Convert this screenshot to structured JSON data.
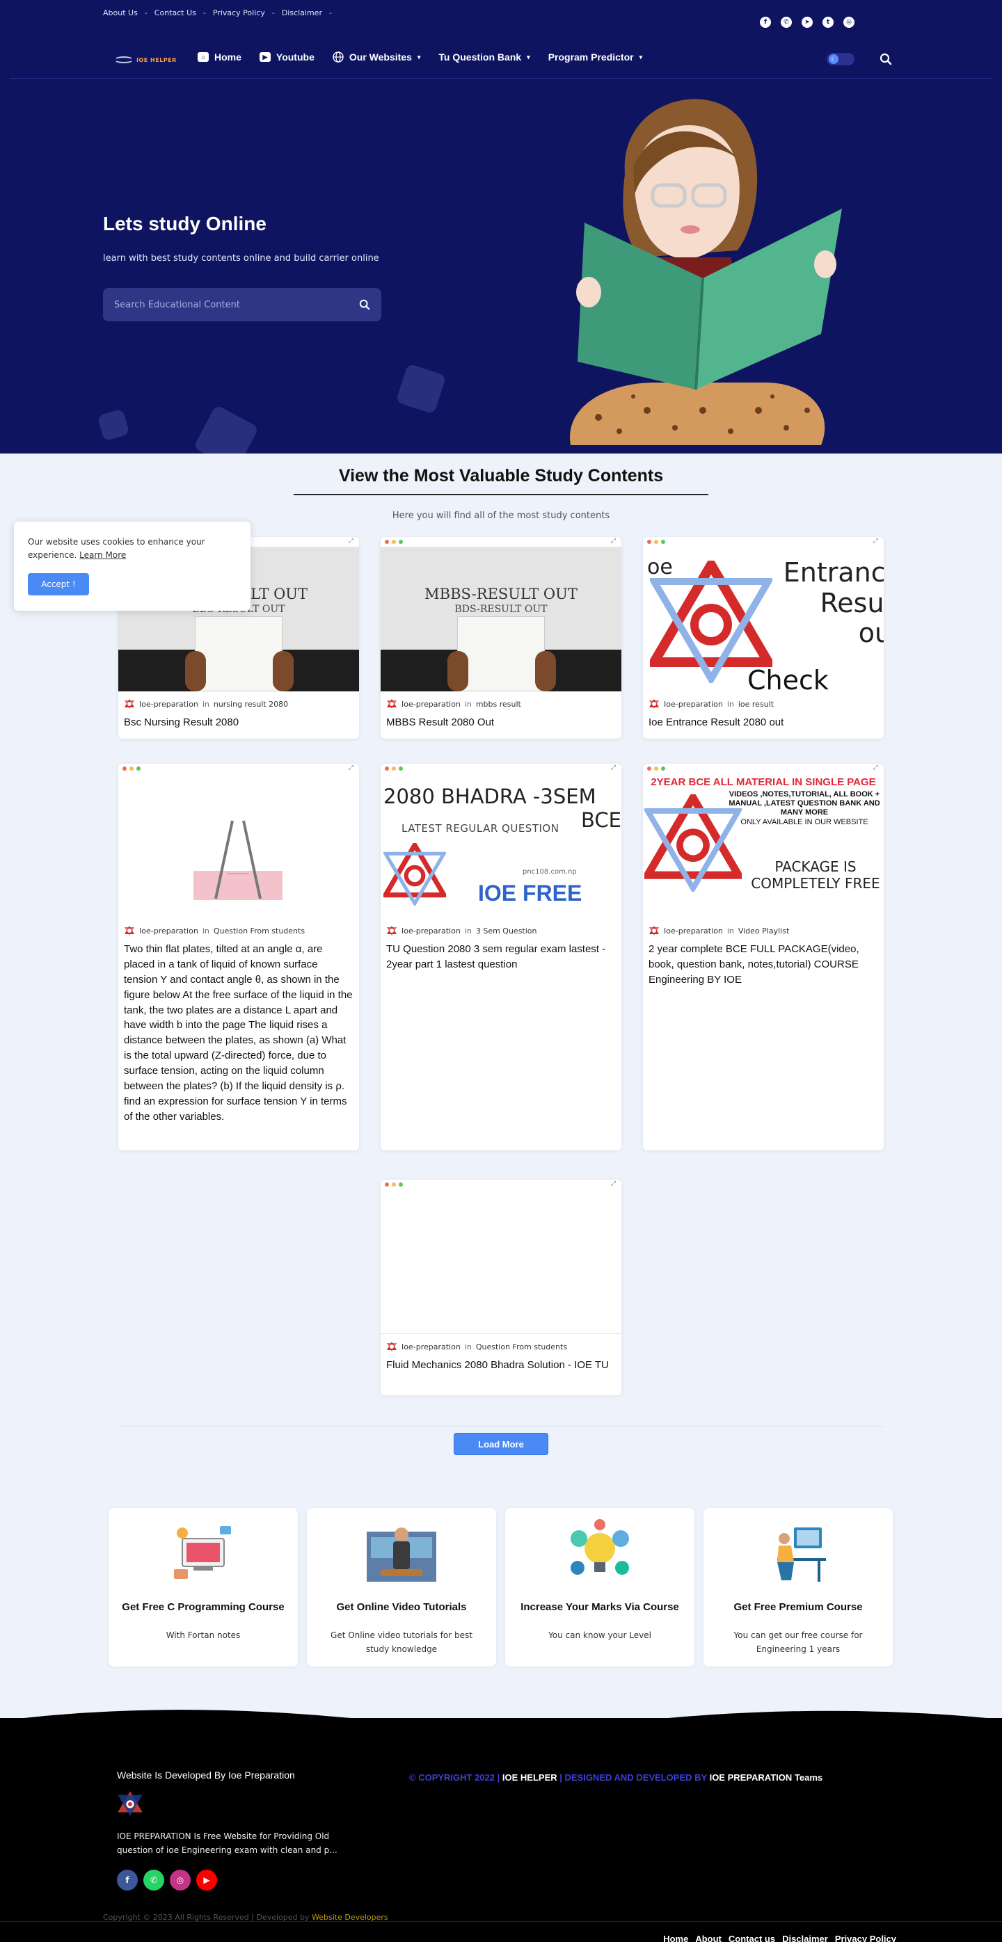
{
  "topbar": {
    "links": [
      "About Us",
      "Contact Us",
      "Privacy Policy",
      "Disclaimer"
    ],
    "separator": "-",
    "social_icons": [
      "facebook-icon",
      "whatsapp-icon",
      "telegram-icon",
      "twitter-icon",
      "instagram-icon"
    ]
  },
  "nav": {
    "logo_text": "IOE HELPER",
    "items": [
      {
        "label": "Home",
        "icon": "home-icon"
      },
      {
        "label": "Youtube",
        "icon": "youtube-icon"
      },
      {
        "label": "Our Websites",
        "icon": "globe-icon",
        "dropdown": true
      },
      {
        "label": "Tu Question Bank",
        "dropdown": true
      },
      {
        "label": "Program Predictor",
        "dropdown": true
      }
    ]
  },
  "hero": {
    "title": "Lets study Online",
    "subtitle": "learn with best study contents online and build carrier online",
    "search_placeholder": "Search Educational Content"
  },
  "section": {
    "title": "View the Most Valuable Study Contents",
    "subtitle": "Here you will find all of the most study contents"
  },
  "cookie": {
    "message": "Our website uses cookies to enhance your experience.",
    "learn_more": "Learn More",
    "accept": "Accept !"
  },
  "posts": [
    {
      "author": "Ioe-preparation",
      "in": "in",
      "category": "nursing result 2080",
      "title": "Bsc Nursing Result 2080",
      "thumb": {
        "line1": "BSC-RESULT OUT",
        "line2": "BDS-RESULT OUT"
      }
    },
    {
      "author": "Ioe-preparation",
      "in": "in",
      "category": "mbbs result",
      "title": "MBBS Result 2080 Out",
      "thumb": {
        "line1": "MBBS-RESULT OUT",
        "line2": "BDS-RESULT OUT"
      }
    },
    {
      "author": "Ioe-preparation",
      "in": "in",
      "category": "ioe result",
      "title": "Ioe Entrance Result 2080 out",
      "thumb": {
        "prefix": "oe",
        "line1": "Entrance",
        "line2": "Result",
        "line3": "out",
        "line4": "Check now"
      }
    },
    {
      "author": "Ioe-preparation",
      "in": "in",
      "category": "Question From students",
      "title": "Two thin flat plates, tilted at an angle α, are placed in a tank of liquid of known surface tension Y and contact angle θ, as shown in the figure below At the free surface of the liquid in the tank, the two plates are a distance L apart and have width b into the page The liquid rises a distance between the plates, as shown (a) What is the total upward (Z-directed) force, due to surface tension, acting on the liquid column between the plates? (b) If the liquid density is ρ. find an expression for surface tension Y in terms of the other variables."
    },
    {
      "author": "Ioe-preparation",
      "in": "in",
      "category": "3 Sem Question",
      "title": "TU Question 2080 3 sem regular exam lastest - 2year part 1 lastest question",
      "thumb": {
        "line1": "2080 BHADRA -3SEM",
        "line2": "BCE",
        "line3": "LATEST REGULAR QUESTION",
        "site": "pnc108.com.np",
        "brand": "IOE FREE"
      }
    },
    {
      "author": "Ioe-preparation",
      "in": "in",
      "category": "Video Playlist",
      "title": "2 year complete BCE FULL PACKAGE(video, book, question bank, notes,tutorial) COURSE Engineering BY IOE",
      "thumb": {
        "band": "2YEAR BCE ALL MATERIAL IN SINGLE PAGE",
        "list": "VIDEOS ,NOTES,TUTORIAL, ALL BOOK + MANUAL ,LATEST QUESTION BANK AND MANY MORE",
        "only": "ONLY AVAILABLE IN OUR WEBSITE",
        "package": "PACKAGE IS COMPLETELY FREE"
      }
    },
    {
      "author": "Ioe-preparation",
      "in": "in",
      "category": "Question From students",
      "title": "Fluid Mechanics 2080 Bhadra Solution - IOE TU"
    }
  ],
  "load_more": "Load More",
  "features": [
    {
      "title": "Get Free C Programming Course",
      "desc": "With Fortan notes"
    },
    {
      "title": "Get Online Video Tutorials",
      "desc": "Get Online video tutorials for best study knowledge"
    },
    {
      "title": "Increase Your Marks Via Course",
      "desc": "You can know your Level"
    },
    {
      "title": "Get Free Premium Course",
      "desc": "You can get our free course for Engineering 1 years"
    }
  ],
  "footer": {
    "developed_by": "Website Is Developed By Ioe Preparation",
    "description": "IOE PREPARATION Is Free Website for Providing Old question of ioe Engineering exam with clean and p...",
    "copyright_prefix": "© COPYRIGHT 2022 |",
    "copyright_brand": "IOE HELPER",
    "copyright_mid": "| DESIGNED AND DEVELOPED BY",
    "copyright_team": "IOE PREPARATION Teams",
    "small_copy": "Copyright © 2023 All Rights Reserved | Developed by",
    "small_dev": "Website Developers",
    "links": [
      "Home",
      "About",
      "Contact us",
      "Disclaimer",
      "Privacy Policy"
    ],
    "social_icons": [
      "facebook-icon",
      "whatsapp-icon",
      "instagram-icon",
      "youtube-icon"
    ]
  },
  "colors": {
    "hero_bg": "#0e1460",
    "page_bg": "#eef2fb",
    "accent_button": "#4a8af4",
    "footer_bg": "#000000",
    "copyright_blue": "#3b3fd6"
  }
}
